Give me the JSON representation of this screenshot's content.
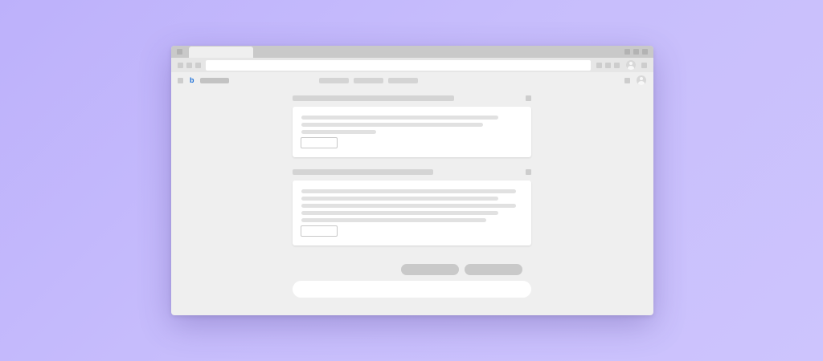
{
  "window": {
    "tab_title": "",
    "url": "",
    "site_name": ""
  },
  "nav": {
    "items": [
      "",
      "",
      ""
    ]
  },
  "icons": {
    "site_logo": "bing-logo-icon",
    "logo_glyph": "b",
    "profile": "person-icon"
  },
  "colors": {
    "background_start": "#bdb1fb",
    "background_end": "#cdc4fd",
    "window_body": "#efefef",
    "tab_strip": "#c9c9c9",
    "logo_blue": "#1b6fd8",
    "card": "#ffffff",
    "placeholder": "#d4d4d4"
  },
  "main": {
    "sections": [
      {
        "heading": "",
        "body_lines": [
          "",
          "",
          ""
        ],
        "button_label": ""
      },
      {
        "heading": "",
        "body_lines": [
          "",
          "",
          "",
          "",
          ""
        ],
        "button_label": ""
      }
    ],
    "suggestion_pills": [
      "",
      ""
    ],
    "chat_input_placeholder": ""
  }
}
